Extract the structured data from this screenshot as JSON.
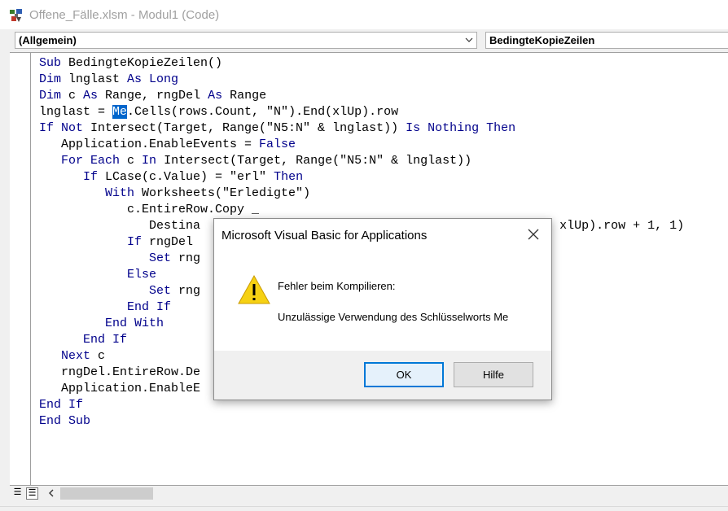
{
  "window": {
    "title": "Offene_Fälle.xlsm - Modul1 (Code)"
  },
  "object_combo": {
    "value": "(Allgemein)"
  },
  "procedure_combo": {
    "value": "BedingteKopieZeilen"
  },
  "code_lines": [
    [
      {
        "t": "Sub ",
        "kw": true
      },
      {
        "t": "BedingteKopieZeilen()"
      }
    ],
    [
      {
        "t": "Dim ",
        "kw": true
      },
      {
        "t": "lnglast "
      },
      {
        "t": "As Long",
        "kw": true
      }
    ],
    [
      {
        "t": "Dim ",
        "kw": true
      },
      {
        "t": "c "
      },
      {
        "t": "As ",
        "kw": true
      },
      {
        "t": "Range, rngDel "
      },
      {
        "t": "As ",
        "kw": true
      },
      {
        "t": "Range"
      }
    ],
    [
      {
        "t": "lnglast = "
      },
      {
        "t": "Me",
        "sel": true
      },
      {
        "t": ".Cells(rows.Count, \"N\").End(xlUp).row"
      }
    ],
    [
      {
        "t": "If Not ",
        "kw": true
      },
      {
        "t": "Intersect(Target, Range(\"N5:N\" & lnglast)) "
      },
      {
        "t": "Is Nothing Then",
        "kw": true
      }
    ],
    [
      {
        "t": "   Application.EnableEvents = "
      },
      {
        "t": "False",
        "kw": true
      }
    ],
    [
      {
        "t": "   For Each ",
        "kw": true
      },
      {
        "t": "c "
      },
      {
        "t": "In ",
        "kw": true
      },
      {
        "t": "Intersect(Target, Range(\"N5:N\" & lnglast))"
      }
    ],
    [
      {
        "t": "      If ",
        "kw": true
      },
      {
        "t": "LCase(c.Value) = \"erl\" "
      },
      {
        "t": "Then",
        "kw": true
      }
    ],
    [
      {
        "t": "         With ",
        "kw": true
      },
      {
        "t": "Worksheets(\"Erledigte\")"
      }
    ],
    [
      {
        "t": "            c.EntireRow.Copy _"
      }
    ],
    [
      {
        "t": "               Destina"
      },
      {
        "t": "                                                 "
      },
      {
        "t": "xlUp).row + 1, 1)"
      }
    ],
    [
      {
        "t": "            If ",
        "kw": true
      },
      {
        "t": "rngDel"
      }
    ],
    [
      {
        "t": "               Set ",
        "kw": true
      },
      {
        "t": "rng"
      }
    ],
    [
      {
        "t": "            Else",
        "kw": true
      }
    ],
    [
      {
        "t": "               Set ",
        "kw": true
      },
      {
        "t": "rng"
      }
    ],
    [
      {
        "t": "            End If",
        "kw": true
      }
    ],
    [
      {
        "t": "         End With",
        "kw": true
      }
    ],
    [
      {
        "t": "      End If",
        "kw": true
      }
    ],
    [
      {
        "t": "   Next ",
        "kw": true
      },
      {
        "t": "c"
      }
    ],
    [
      {
        "t": "   rngDel.EntireRow.De"
      }
    ],
    [
      {
        "t": "   Application.EnableE"
      }
    ],
    [
      {
        "t": "End If",
        "kw": true
      }
    ],
    [
      {
        "t": "End Sub",
        "kw": true
      }
    ]
  ],
  "dialog": {
    "title": "Microsoft Visual Basic for Applications",
    "message_line1": "Fehler beim Kompilieren:",
    "message_line2": "Unzulässige Verwendung des Schlüsselworts Me",
    "ok_label": "OK",
    "help_label": "Hilfe"
  },
  "colors": {
    "keyword": "#00008b",
    "selection": "#0066cc",
    "ok_border": "#0078d7",
    "warning": "#f6d113"
  },
  "icons": [
    "vba-project-icon",
    "chevron-down-icon",
    "close-icon",
    "warning-icon",
    "procedure-view-icon",
    "full-module-view-icon",
    "scroll-left-icon"
  ]
}
